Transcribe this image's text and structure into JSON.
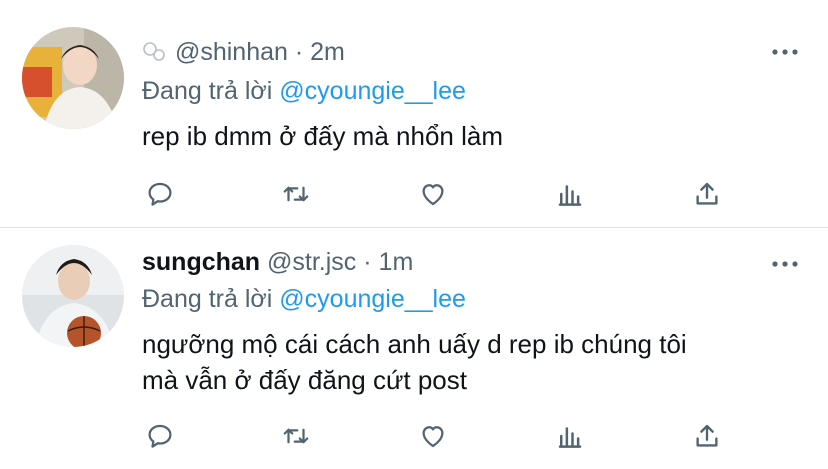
{
  "tweets": [
    {
      "display_name": "",
      "handle": "@shinhan",
      "separator": "·",
      "time": "2m",
      "reply_prefix": "Đang trả lời",
      "reply_to": "@cyoungie__lee",
      "text_lines": [
        "rep ib dmm ở đấy mà nhổn làm"
      ]
    },
    {
      "display_name": "sungchan",
      "handle": "@str.jsc",
      "separator": "·",
      "time": "1m",
      "reply_prefix": "Đang trả lời",
      "reply_to": "@cyoungie__lee",
      "text_lines": [
        "ngưỡng mộ cái cách anh uấy d rep ib chúng tôi",
        "mà vẫn ở đấy đăng cứt post"
      ]
    }
  ],
  "icons": {
    "reply": "comment-icon",
    "retweet": "retweet-icon",
    "like": "heart-icon",
    "analytics": "bar-chart-icon",
    "share": "share-icon",
    "more": "more-icon"
  },
  "colors": {
    "accent": "#1d9bf0",
    "secondary_text": "#536471",
    "icon": "#536471"
  }
}
